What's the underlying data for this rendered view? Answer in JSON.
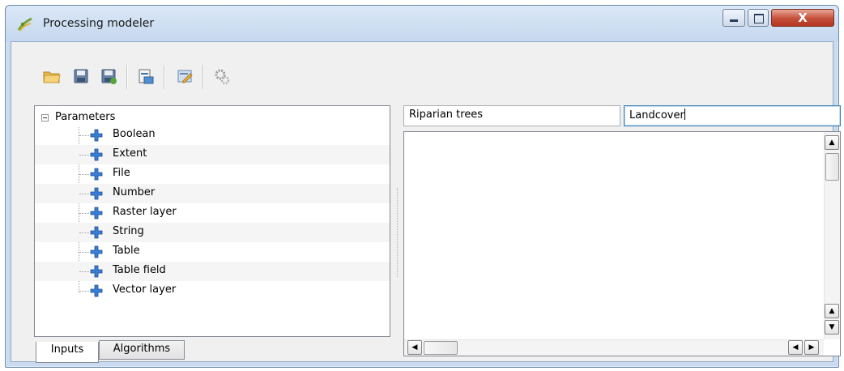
{
  "window": {
    "title": "Processing modeler",
    "controls": {
      "minimize_icon": "minimize-icon",
      "maximize_icon": "maximize-icon",
      "close_icon": "close-icon",
      "close_glyph": "X"
    }
  },
  "toolbar": {
    "buttons": [
      {
        "name": "open-model-button",
        "icon": "folder-open-icon"
      },
      {
        "name": "save-button",
        "icon": "floppy-disk-icon"
      },
      {
        "name": "save-as-button",
        "icon": "floppy-disk-plus-icon"
      },
      {
        "name": "export-image-button",
        "icon": "export-image-icon"
      },
      {
        "name": "edit-help-button",
        "icon": "edit-help-icon"
      },
      {
        "name": "run-model-button",
        "icon": "gears-icon"
      }
    ]
  },
  "inputs_tree": {
    "root_label": "Parameters",
    "items": [
      "Boolean",
      "Extent",
      "File",
      "Number",
      "Raster layer",
      "String",
      "Table",
      "Table field",
      "Vector layer"
    ]
  },
  "tabs": [
    {
      "label": "Inputs",
      "active": true
    },
    {
      "label": "Algorithms",
      "active": false
    }
  ],
  "model": {
    "name_value": "Riparian trees",
    "group_value": "Landcover"
  },
  "colors": {
    "accent": "#3c7fb1",
    "titlebar": "#c5d8ef",
    "close_button": "#c34f3a",
    "parameter_icon": "#3a7dd8"
  }
}
